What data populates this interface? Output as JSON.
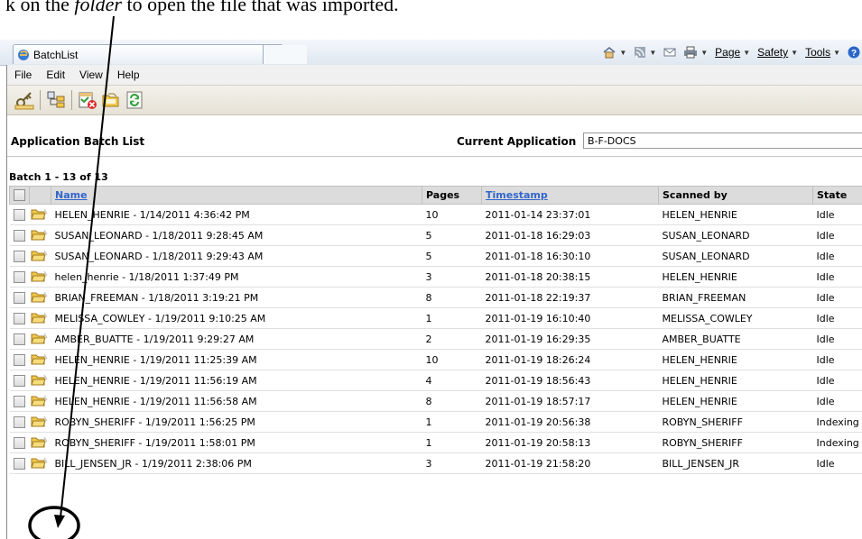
{
  "caption": {
    "prefix": "k on the ",
    "emphasis": "folder",
    "suffix": " to open the file that was imported."
  },
  "browser": {
    "tab_title": "BatchList",
    "commands": {
      "page": "Page",
      "safety": "Safety",
      "tools": "Tools"
    }
  },
  "menu": [
    "File",
    "Edit",
    "View",
    "Help"
  ],
  "toolbar_icons": [
    "key-icon",
    "tree-icon",
    "delete-batch-icon",
    "open-folder-icon",
    "refresh-icon"
  ],
  "header": {
    "title": "Application Batch List",
    "current_app_label": "Current Application",
    "current_app_value": "B-F-DOCS"
  },
  "batch_count": "Batch 1 - 13 of 13",
  "columns": {
    "name": "Name",
    "pages": "Pages",
    "timestamp": "Timestamp",
    "scanned_by": "Scanned by",
    "state": "State"
  },
  "rows": [
    {
      "name": "HELEN_HENRIE - 1/14/2011 4:36:42 PM",
      "pages": "10",
      "timestamp": "2011-01-14 23:37:01",
      "scanned_by": "HELEN_HENRIE",
      "state": "Idle"
    },
    {
      "name": "SUSAN_LEONARD - 1/18/2011 9:28:45 AM",
      "pages": "5",
      "timestamp": "2011-01-18 16:29:03",
      "scanned_by": "SUSAN_LEONARD",
      "state": "Idle"
    },
    {
      "name": "SUSAN_LEONARD - 1/18/2011 9:29:43 AM",
      "pages": "5",
      "timestamp": "2011-01-18 16:30:10",
      "scanned_by": "SUSAN_LEONARD",
      "state": "Idle"
    },
    {
      "name": "helen_henrie - 1/18/2011 1:37:49 PM",
      "pages": "3",
      "timestamp": "2011-01-18 20:38:15",
      "scanned_by": "HELEN_HENRIE",
      "state": "Idle"
    },
    {
      "name": "BRIAN_FREEMAN - 1/18/2011 3:19:21 PM",
      "pages": "8",
      "timestamp": "2011-01-18 22:19:37",
      "scanned_by": "BRIAN_FREEMAN",
      "state": "Idle"
    },
    {
      "name": "MELISSA_COWLEY - 1/19/2011 9:10:25 AM",
      "pages": "1",
      "timestamp": "2011-01-19 16:10:40",
      "scanned_by": "MELISSA_COWLEY",
      "state": "Idle"
    },
    {
      "name": "AMBER_BUATTE - 1/19/2011 9:29:27 AM",
      "pages": "2",
      "timestamp": "2011-01-19 16:29:35",
      "scanned_by": "AMBER_BUATTE",
      "state": "Idle"
    },
    {
      "name": "HELEN_HENRIE - 1/19/2011 11:25:39 AM",
      "pages": "10",
      "timestamp": "2011-01-19 18:26:24",
      "scanned_by": "HELEN_HENRIE",
      "state": "Idle"
    },
    {
      "name": "HELEN_HENRIE - 1/19/2011 11:56:19 AM",
      "pages": "4",
      "timestamp": "2011-01-19 18:56:43",
      "scanned_by": "HELEN_HENRIE",
      "state": "Idle"
    },
    {
      "name": "HELEN_HENRIE - 1/19/2011 11:56:58 AM",
      "pages": "8",
      "timestamp": "2011-01-19 18:57:17",
      "scanned_by": "HELEN_HENRIE",
      "state": "Idle"
    },
    {
      "name": "ROBYN_SHERIFF - 1/19/2011 1:56:25 PM",
      "pages": "1",
      "timestamp": "2011-01-19 20:56:38",
      "scanned_by": "ROBYN_SHERIFF",
      "state": "Indexing"
    },
    {
      "name": "ROBYN_SHERIFF - 1/19/2011 1:58:01 PM",
      "pages": "1",
      "timestamp": "2011-01-19 20:58:13",
      "scanned_by": "ROBYN_SHERIFF",
      "state": "Indexing"
    },
    {
      "name": "BILL_JENSEN_JR - 1/19/2011 2:38:06 PM",
      "pages": "3",
      "timestamp": "2011-01-19 21:58:20",
      "scanned_by": "BILL_JENSEN_JR",
      "state": "Idle"
    }
  ],
  "colors": {
    "header_link": "#3366cc",
    "folder_icon": "#f2c94c",
    "annotation": "#000000"
  }
}
